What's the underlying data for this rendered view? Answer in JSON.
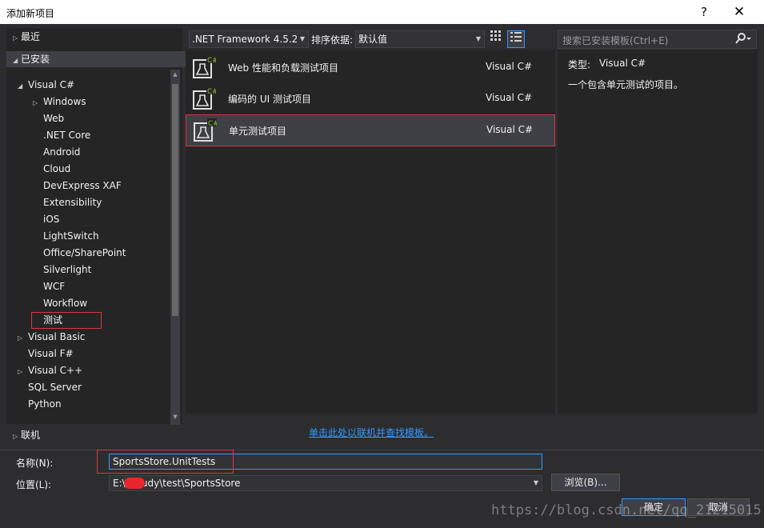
{
  "window": {
    "title": "添加新项目",
    "help_label": "?",
    "close_label": "✕"
  },
  "left_tree": {
    "recent": "最近",
    "installed": "已安装",
    "items": [
      {
        "label": "Visual C#",
        "indent": 1,
        "arrow": "◢"
      },
      {
        "label": "Windows",
        "indent": 2,
        "arrow": "▷"
      },
      {
        "label": "Web",
        "indent": 2,
        "arrow": ""
      },
      {
        "label": ".NET Core",
        "indent": 2,
        "arrow": ""
      },
      {
        "label": "Android",
        "indent": 2,
        "arrow": ""
      },
      {
        "label": "Cloud",
        "indent": 2,
        "arrow": ""
      },
      {
        "label": "DevExpress XAF",
        "indent": 2,
        "arrow": ""
      },
      {
        "label": "Extensibility",
        "indent": 2,
        "arrow": ""
      },
      {
        "label": "iOS",
        "indent": 2,
        "arrow": ""
      },
      {
        "label": "LightSwitch",
        "indent": 2,
        "arrow": ""
      },
      {
        "label": "Office/SharePoint",
        "indent": 2,
        "arrow": ""
      },
      {
        "label": "Silverlight",
        "indent": 2,
        "arrow": ""
      },
      {
        "label": "WCF",
        "indent": 2,
        "arrow": ""
      },
      {
        "label": "Workflow",
        "indent": 2,
        "arrow": ""
      },
      {
        "label": "测试",
        "indent": 2,
        "arrow": ""
      },
      {
        "label": "Visual Basic",
        "indent": 1,
        "arrow": "▷"
      },
      {
        "label": "Visual F#",
        "indent": 1,
        "arrow": ""
      },
      {
        "label": "Visual C++",
        "indent": 1,
        "arrow": "▷"
      },
      {
        "label": "SQL Server",
        "indent": 1,
        "arrow": ""
      },
      {
        "label": "Python",
        "indent": 1,
        "arrow": ""
      }
    ],
    "online": "联机"
  },
  "toolbar": {
    "framework": ".NET Framework 4.5.2",
    "sort_label": "排序依据:",
    "sort_value": "默认值",
    "search_placeholder": "搜索已安装模板(Ctrl+E)"
  },
  "templates": [
    {
      "name": "Web 性能和负载测试项目",
      "lang": "Visual C#"
    },
    {
      "name": "编码的 UI 测试项目",
      "lang": "Visual C#"
    },
    {
      "name": "单元测试项目",
      "lang": "Visual C#",
      "selected": true
    }
  ],
  "details": {
    "type_label": "类型:",
    "type_value": "Visual C#",
    "description": "一个包含单元测试的项目。"
  },
  "online_link": "单击此处以联机并查找模板。",
  "form": {
    "name_label": "名称(N):",
    "name_value": "SportsStore.UnitTests",
    "location_label": "位置(L):",
    "location_value": "E:\\        \\Study\\test\\SportsStore",
    "browse_label": "浏览(B)...",
    "ok_label": "确定",
    "cancel_label": "取消"
  },
  "watermark": "https://blog.csdn.net/qq_21215015",
  "colors": {
    "background": "#2d2d30",
    "panel": "#252526",
    "accent": "#3399ff",
    "highlight_box": "#d9373d"
  }
}
